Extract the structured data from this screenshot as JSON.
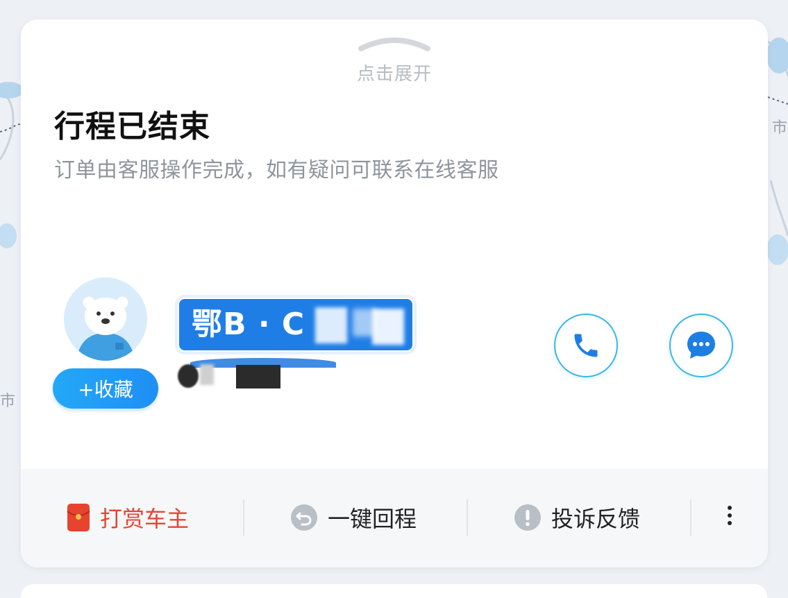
{
  "card": {
    "expand_hint": "点击展开",
    "title": "行程已结束",
    "subtitle": "订单由客服操作完成，如有疑问可联系在线客服"
  },
  "driver": {
    "plate_visible": "鄂B · C",
    "favorite_label": "+收藏"
  },
  "actions": [
    {
      "label": "打赏车主",
      "icon": "red-envelope-icon"
    },
    {
      "label": "一键回程",
      "icon": "return-icon"
    },
    {
      "label": "投诉反馈",
      "icon": "alert-icon"
    }
  ],
  "map": {
    "label_right": "市",
    "label_left": "市"
  },
  "colors": {
    "accent_blue": "#1f7ee6",
    "tip_red": "#e54533",
    "button_ring": "#37b6e6"
  }
}
